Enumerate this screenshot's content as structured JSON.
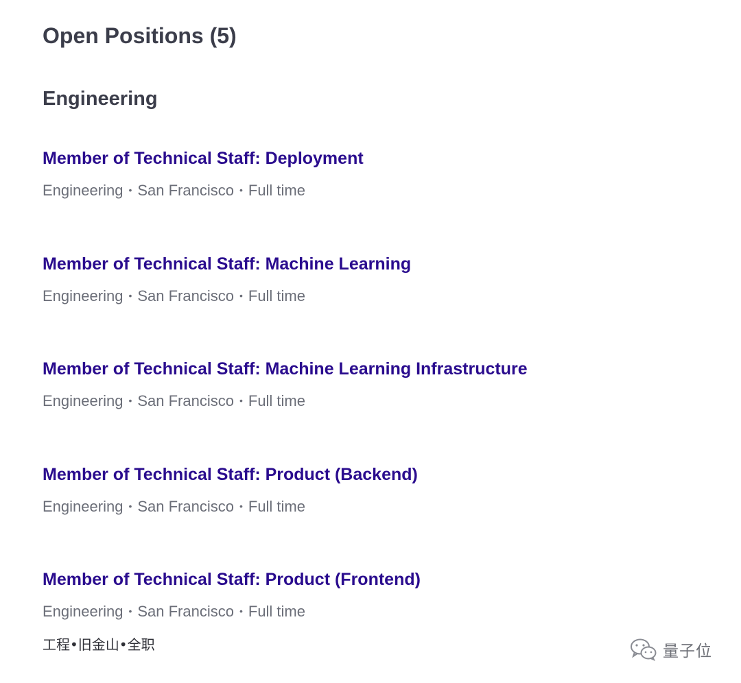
{
  "page": {
    "title": "Open Positions (5)"
  },
  "section": {
    "title": "Engineering"
  },
  "jobs": [
    {
      "title": "Member of Technical Staff: Deployment",
      "department": "Engineering",
      "location": "San Francisco",
      "type": "Full time"
    },
    {
      "title": "Member of Technical Staff: Machine Learning",
      "department": "Engineering",
      "location": "San Francisco",
      "type": "Full time"
    },
    {
      "title": "Member of Technical Staff: Machine Learning Infrastructure",
      "department": "Engineering",
      "location": "San Francisco",
      "type": "Full time"
    },
    {
      "title": "Member of Technical Staff: Product (Backend)",
      "department": "Engineering",
      "location": "San Francisco",
      "type": "Full time"
    },
    {
      "title": "Member of Technical Staff: Product (Frontend)",
      "department": "Engineering",
      "location": "San Francisco",
      "type": "Full time"
    }
  ],
  "meta_separator": "•",
  "translation": "工程•旧金山•全职",
  "watermark": {
    "text": "量子位",
    "icon": "wechat-icon"
  },
  "colors": {
    "heading": "#3b3d4a",
    "link": "#2a0c8e",
    "meta": "#6b6e78"
  }
}
